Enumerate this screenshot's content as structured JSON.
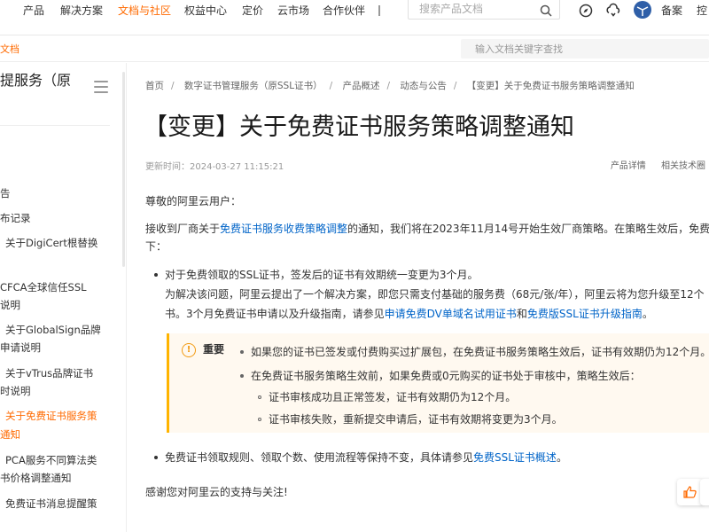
{
  "colors": {
    "accent": "#ff6a00",
    "link": "#0064c8",
    "note_border": "#ffb400",
    "note_bg": "#fff9f0"
  },
  "topnav": {
    "items": [
      "产品",
      "解决方案",
      "文档与社区",
      "权益中心",
      "定价",
      "云市场",
      "合作伙伴"
    ],
    "active": "文档与社区",
    "search_placeholder": "搜索产品文档",
    "right_label": "备案",
    "right_label_2": "控",
    "icons": [
      "search-icon",
      "compass-icon",
      "cloud-sync-icon",
      "globe-icon"
    ]
  },
  "subbar": {
    "crumb": "文档",
    "search_placeholder": "输入文档关键字查找"
  },
  "sidebar": {
    "title": "提服务（原",
    "items": [
      {
        "text": "告",
        "active": false
      },
      {
        "text": "布记录",
        "active": false
      },
      {
        "text": "关于DigiCert根替换",
        "active": false
      },
      {
        "text": "CFCA全球信任SSL",
        "active": false
      },
      {
        "text": "说明",
        "active": false
      },
      {
        "text": "关于GlobalSign品牌",
        "active": false
      },
      {
        "text": "申请说明",
        "active": false
      },
      {
        "text": "关于vTrus品牌证书",
        "active": false
      },
      {
        "text": "时说明",
        "active": false
      },
      {
        "text": "关于免费证书服务策",
        "active": true
      },
      {
        "text": "通知",
        "active": true
      },
      {
        "text": "PCA服务不同算法类",
        "active": false
      },
      {
        "text": "书价格调整通知",
        "active": false
      },
      {
        "text": "免费证书消息提醒策",
        "active": false
      }
    ]
  },
  "breadcrumb": [
    "首页",
    "数字证书管理服务（原SSL证书）",
    "产品概述",
    "动态与公告",
    "【变更】关于免费证书服务策略调整通知"
  ],
  "article": {
    "title": "【变更】关于免费证书服务策略调整通知",
    "updated": "更新时间：2024-03-27 11:15:21",
    "meta_links": [
      "产品详情",
      "相关技术圈"
    ],
    "greeting": "尊敬的阿里云用户：",
    "intro_a": "接收到厂商关于",
    "intro_link": "免费证书服务收费策略调整",
    "intro_b": "的通知，我们将在2023年11月14号开始生效厂商策略。在策略生效后，免费",
    "intro_c": "下：",
    "b1_line1": "对于免费领取的SSL证书，签发后的证书有效期统一变更为3个月。",
    "b1_line2": "为解决该问题，阿里云提出了一个解决方案，即您只需支付基础的服务费（68元/张/年），阿里云将为您升级至12个",
    "b1_line3_a": "书。3个月免费证书申请以及升级指南，请参见",
    "b1_link1": "申请免费DV单域名试用证书",
    "b1_and": "和",
    "b1_link2": "免费版SSL证书升级指南",
    "b1_end": "。",
    "note_label": "重要",
    "note_1": "如果您的证书已签发或付费购买过扩展包，在免费证书服务策略生效后，证书有效期仍为12个月。",
    "note_2": "在免费证书服务策略生效前，如果免费或0元购买的证书处于审核中，策略生效后：",
    "note_2a": "证书审核成功且正常签发，证书有效期仍为12个月。",
    "note_2b": "证书审核失败，重新提交申请后，证书有效期将变更为3个月。",
    "b2_a": "免费证书领取规则、领取个数、使用流程等保持不变，具体请参见",
    "b2_link": "免费SSL证书概述",
    "b2_end": "。",
    "closing": "感谢您对阿里云的支持与关注!"
  }
}
